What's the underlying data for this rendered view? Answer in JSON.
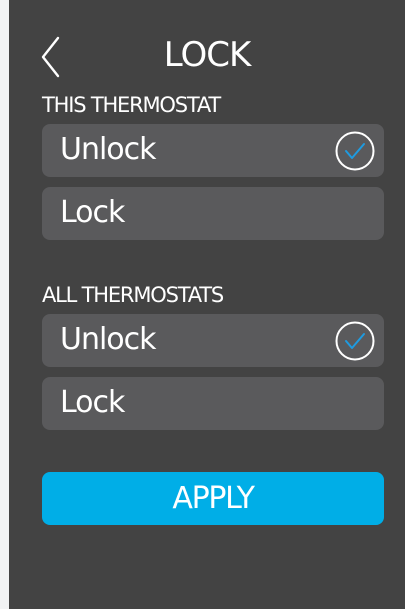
{
  "header": {
    "title": "LOCK",
    "back_icon": "chevron-left-icon"
  },
  "sections": [
    {
      "title": "THIS THERMOSTAT",
      "options": [
        {
          "label": "Unlock",
          "selected": true
        },
        {
          "label": "Lock",
          "selected": false
        }
      ]
    },
    {
      "title": "ALL THERMOSTATS",
      "options": [
        {
          "label": "Unlock",
          "selected": true
        },
        {
          "label": "Lock",
          "selected": false
        }
      ]
    }
  ],
  "actions": {
    "apply_label": "APPLY"
  },
  "colors": {
    "background": "#434343",
    "option_background": "#5a5a5c",
    "accent": "#00aee7",
    "check_mark": "#1e9be0",
    "text": "#ffffff"
  },
  "icons": {
    "selected": "check-circle-icon"
  }
}
